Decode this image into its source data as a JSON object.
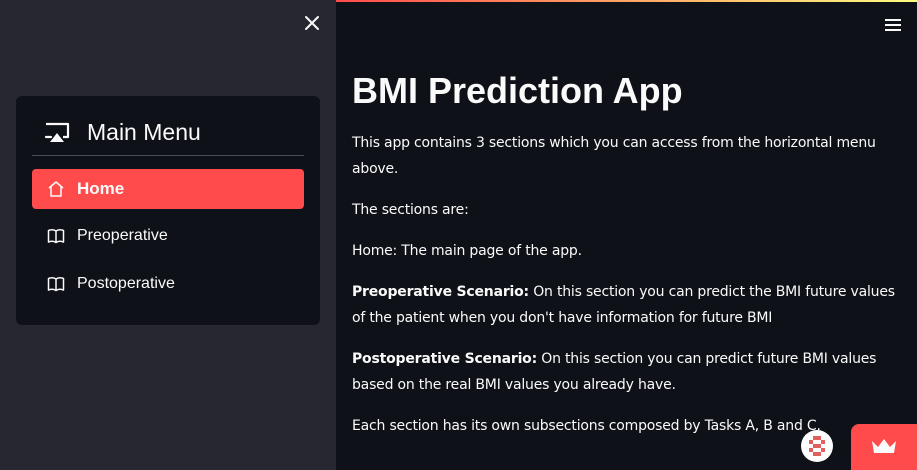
{
  "sidebar": {
    "close_icon": "close-icon",
    "menu": {
      "title": "Main Menu",
      "title_icon": "cast-icon",
      "items": [
        {
          "label": "Home",
          "icon": "house-icon",
          "active": true
        },
        {
          "label": "Preoperative",
          "icon": "book-icon",
          "active": false
        },
        {
          "label": "Postoperative",
          "icon": "book-icon",
          "active": false
        }
      ]
    }
  },
  "header": {
    "menu_icon": "hamburger-icon"
  },
  "main": {
    "title": "BMI Prediction App",
    "intro": "This app contains 3 sections which you can access from the horizontal menu above.",
    "sections_label": "The sections are:",
    "home_desc": "Home: The main page of the app.",
    "pre_title": "Preoperative Scenario:",
    "pre_desc": " On this section you can predict the BMI future values of the patient when you don't have information for future BMI",
    "post_title": "Postoperative Scenario:",
    "post_desc": " On this section you can predict future BMI values based on the real BMI values you already have.",
    "subsections": "Each section has its own subsections composed by Tasks A, B and C."
  },
  "colors": {
    "accent": "#ff4b4b",
    "sidebar_bg": "#262730",
    "main_bg": "#0e1117"
  }
}
